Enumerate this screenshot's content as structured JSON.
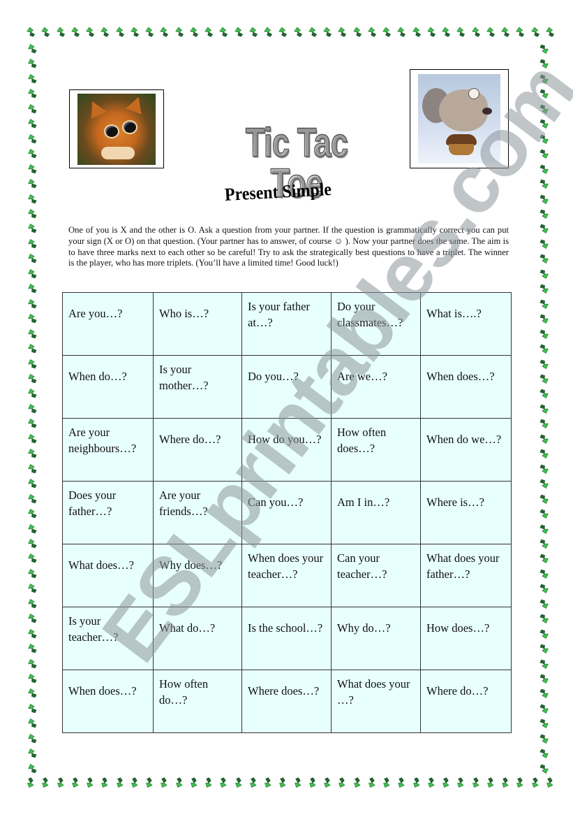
{
  "title": "Tic Tac Toe",
  "subtitle": "Present Simple",
  "images": {
    "left": "puss-in-boots-cat-image",
    "right": "scrat-squirrel-acorn-image"
  },
  "instructions": "One of you is X and the other is O. Ask a question from your partner. If the question is grammatically correct you can put your sign (X or O) on that question. (Your partner has to answer, of course ☺ ). Now your partner does the same. The aim is to have three marks next to each other so be careful! Try to ask the strategically best questions to have a triplet.  The winner is the player, who has more triplets. (You’ll have a limited time!  Good luck!)",
  "board": {
    "rows": [
      [
        "Are you…?",
        "Who is…?",
        "Is your father at…?",
        "Do your classmates…?",
        "What is….?"
      ],
      [
        "When do…?",
        "Is your mother…?",
        "Do you…?",
        "Are we…?",
        "When does…?"
      ],
      [
        "Are your neighbours…?",
        "Where do…?",
        "How do you…?",
        "How often does…?",
        "When do we…?"
      ],
      [
        "Does your father…?",
        "Are your friends…?",
        "Can you…?",
        "Am I in…?",
        "Where is…?"
      ],
      [
        "What does…?",
        "Why does…?",
        "When does your teacher…?",
        "Can your teacher…?",
        "What does your father…?"
      ],
      [
        "Is your teacher…?",
        "What do…?",
        "Is the school…?",
        "Why do…?",
        "How does…?"
      ],
      [
        "When does…?",
        "How often do…?",
        "Where does…?",
        "What does your …?",
        "Where do…?"
      ]
    ]
  },
  "watermark": "ESLprintables.com",
  "colors": {
    "cell_background": "#e8ffff",
    "border_leaf_light": "#3fbf4f",
    "border_leaf_dark": "#1f6b2f",
    "watermark": "#8c969b"
  }
}
